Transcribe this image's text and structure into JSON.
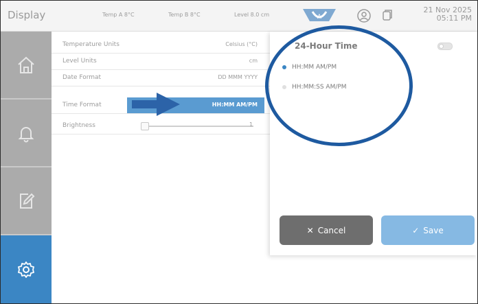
{
  "header": {
    "title": "Display",
    "temp_a": "Temp A  8°C",
    "temp_b": "Temp B  8°C",
    "level": "Level  8.0 cm",
    "date": "21 Nov 2025",
    "time": "05:11 PM"
  },
  "sidebar": {
    "items": [
      {
        "name": "home",
        "active": false
      },
      {
        "name": "alarms",
        "active": false
      },
      {
        "name": "logs",
        "active": false
      },
      {
        "name": "settings",
        "active": true
      }
    ]
  },
  "settings": {
    "rows": [
      {
        "label": "Temperature Units",
        "value": "Celsius (°C)"
      },
      {
        "label": "Level Units",
        "value": "cm"
      },
      {
        "label": "Date Format",
        "value": "DD MMM YYYY"
      },
      {
        "label": "Time Format",
        "value": "HH:MM AM/PM"
      },
      {
        "label": "Brightness",
        "value": "1"
      }
    ]
  },
  "popup": {
    "title": "24-Hour Time",
    "toggle_on": false,
    "options": [
      {
        "label": "HH:MM AM/PM",
        "selected": true
      },
      {
        "label": "HH:MM:SS AM/PM",
        "selected": false
      }
    ],
    "cancel_label": "Cancel",
    "save_label": "Save"
  },
  "colors": {
    "accent": "#3b86c4",
    "sidebar": "#a9a9a9",
    "annotation": "#1e5aa0",
    "cancel": "#6e6e6e",
    "save": "#86b9e3"
  }
}
